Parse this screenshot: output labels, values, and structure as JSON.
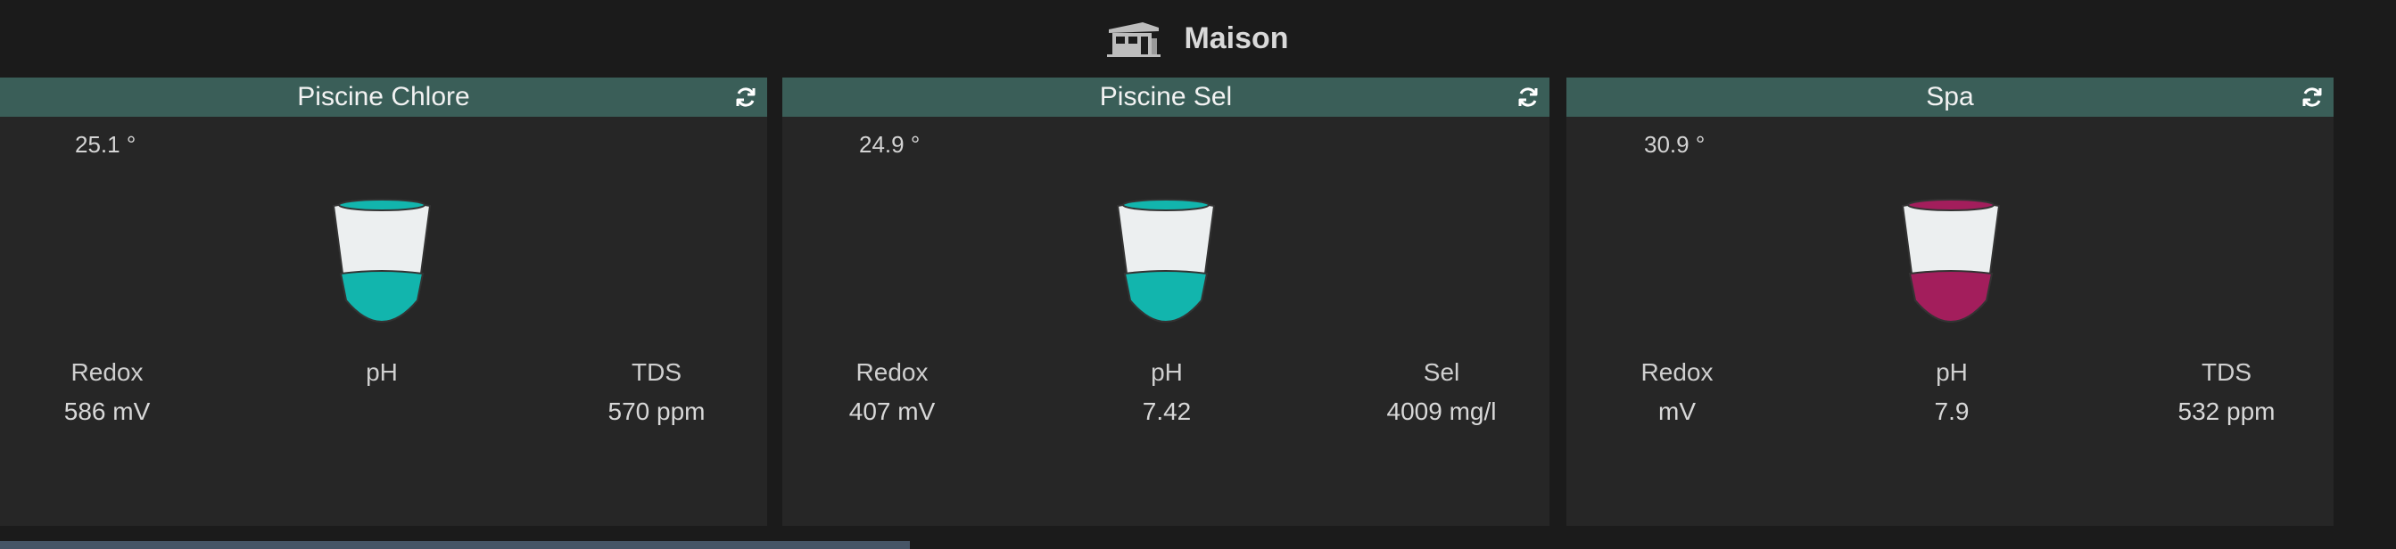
{
  "header": {
    "title": "Maison",
    "icon": "house-icon"
  },
  "colors": {
    "card_header": "#3a5e58",
    "chlorine_water": "#12b5ad",
    "salt_water": "#12b5ad",
    "spa_water": "#a31e5c"
  },
  "cards": [
    {
      "title": "Piscine Chlore",
      "temperature": "25.1 °",
      "metrics": [
        {
          "label": "Redox",
          "value": "586 mV"
        },
        {
          "label": "pH",
          "value": ""
        },
        {
          "label": "TDS",
          "value": "570 ppm"
        }
      ]
    },
    {
      "title": "Piscine Sel",
      "temperature": "24.9 °",
      "metrics": [
        {
          "label": "Redox",
          "value": "407 mV"
        },
        {
          "label": "pH",
          "value": "7.42"
        },
        {
          "label": "Sel",
          "value": "4009 mg/l"
        }
      ]
    },
    {
      "title": "Spa",
      "temperature": "30.9 °",
      "metrics": [
        {
          "label": "Redox",
          "value": "mV"
        },
        {
          "label": "pH",
          "value": "7.9"
        },
        {
          "label": "TDS",
          "value": "532 ppm"
        }
      ]
    }
  ]
}
